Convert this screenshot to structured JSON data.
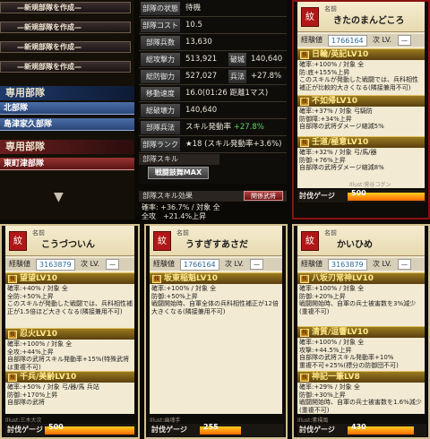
{
  "left_panel": {
    "new_button_label": "—新規部隊を作成—",
    "section_unit": "専用部隊",
    "unit_row_1": "北部隊",
    "unit_row_2": "島津家久部隊",
    "section_unit_2": "専用部隊",
    "unit_row_3": "東町津部隊"
  },
  "stats": {
    "state_label": "部隊の状態",
    "state_value": "待機",
    "cost_label": "部隊コスト",
    "cost_value": "10.5",
    "troops_label": "部隊兵数",
    "troops_value": "13,630",
    "attack_label": "総攻撃力",
    "attack_value": "513,921",
    "breach_label": "破城",
    "breach_value": "140,640",
    "defense_label": "総防御力",
    "defense_value": "527,027",
    "tactics_label": "兵法",
    "tactics_value": "+27.8%",
    "move_label": "移動速度",
    "move_value": "16.0(01:26 距離1マス)",
    "destroy_label": "総破壊力",
    "destroy_value": "140,640",
    "unit_tactics_label": "部隊兵法",
    "unit_tactics_prefix": "スキル発動率",
    "unit_tactics_value": "+27.8%",
    "rank_label": "部隊ランク",
    "rank_value": "★18 (スキル発動率+3.6%)",
    "skill_header": "部隊スキル",
    "skill_button": "戦闘鼓舞MAX",
    "effect_header": "部隊スキル効果",
    "related_button": "関係武将",
    "effect_line1": "確率: +36.7% / 対象 全",
    "effect_line2": "全攻　+21.4%上昇"
  },
  "cards": [
    {
      "name_tag": "名前",
      "name": "きたのまんどころ",
      "exp_label": "経験値",
      "exp": "1766164",
      "lv_label": "次 LV.",
      "lv": "—",
      "s1": "日輪/英記LV10",
      "s1d": "確率:+100% / 対象 全\n防:底+155%上昇\nこのスキルが発動した戦闘では、兵科相性補正が比較的大きくなる(隣接兼用不可)",
      "s2": "不如帰LV10",
      "s2d": "確率:+37% / 対象 弓騎防\n防御障:+34%上昇\n自部隊の武将ダメージ縮減5%",
      "s3": "壬道/極意LV10",
      "s3d": "確率:+32% / 対象 弓/馬/器\n防御:+76%上昇\n自部隊の武将ダメージ縮減8%",
      "tag": "Illust:菅谷コグン",
      "gauge_label": "討伐ゲージ",
      "gauge_value": "500",
      "gauge_fill": 1.0
    },
    {
      "name_tag": "名前",
      "name": "こうづついん",
      "exp_label": "経験値",
      "exp": "3163879",
      "lv_label": "次 LV.",
      "lv": "—",
      "s1": "望望LV10",
      "s1d": "確率:+40% / 対象 全\n全防:+50%上昇\nこのスキルが発動した戦闘では、兵科相性補正が1.5倍ほど大きくなる(隣接兼用不可)",
      "s2": "忍火LV10",
      "s2d": "確率:+100% / 対象 全\n全攻:+44%上昇\n自部隊の武将スキル発動率+15%(特殊武将は重複不可)",
      "s3": "千兵/美齢LV10",
      "s3d": "確率:+50% / 対象 弓/器/馬 兵站\n防御:+170%上昇\n自部隊の武将",
      "tag": "Illust:三木大次",
      "gauge_label": "討伐ゲージ",
      "gauge_value": "500",
      "gauge_fill": 1.0
    },
    {
      "name_tag": "名前",
      "name": "うすぎすあさだ",
      "exp_label": "経験値",
      "exp": "1766164",
      "lv_label": "次 LV.",
      "lv": "—",
      "s1": "坂東稲魁LV10",
      "s1d": "確率:+100% / 対象 全\n防御:+50%上昇\n戦闘開始時、自軍全体の兵科相性補正が12倍大きくなる(隣接兼用不可)",
      "tag": "Illust:幽魂手",
      "gauge_label": "討伐ゲージ",
      "gauge_value": "255",
      "gauge_fill": 0.51
    },
    {
      "name_tag": "名前",
      "name": "かいひめ",
      "exp_label": "経験値",
      "exp": "3163879",
      "lv_label": "次 LV.",
      "lv": "—",
      "s1": "八坂刃常神LV10",
      "s1d": "確率:+100% / 対象 全\n防御:+20%上昇\n戦闘開始時、自軍の兵士被害数を3%減少(重複不可)",
      "s2": "清質/逗響LV10",
      "s2d": "確率:+100% / 対象 全\n攻撃:+44.5%上昇\n自部隊の武将スキル発動率+10%\n重複不可+25%(標分の防御団不可)",
      "s3": "神記一筆LV8",
      "s3d": "確率:+29% / 対象 全\n防御:+30%上昇\n戦闘開始時、自軍の兵士被害数を1.6%減少(重複不可)",
      "tag": "Illust:素樸風",
      "gauge_label": "討伐ゲージ",
      "gauge_value": "430",
      "gauge_fill": 0.86
    }
  ],
  "colors": {
    "skill_bar": "#9a7a20",
    "gauge_fill": "#ff6a00",
    "panel_bg": "#f2ead2",
    "card_border_red": "#8a1010"
  },
  "icons": {
    "kamon": "clan-crest-icon",
    "down": "down-arrow-icon"
  }
}
